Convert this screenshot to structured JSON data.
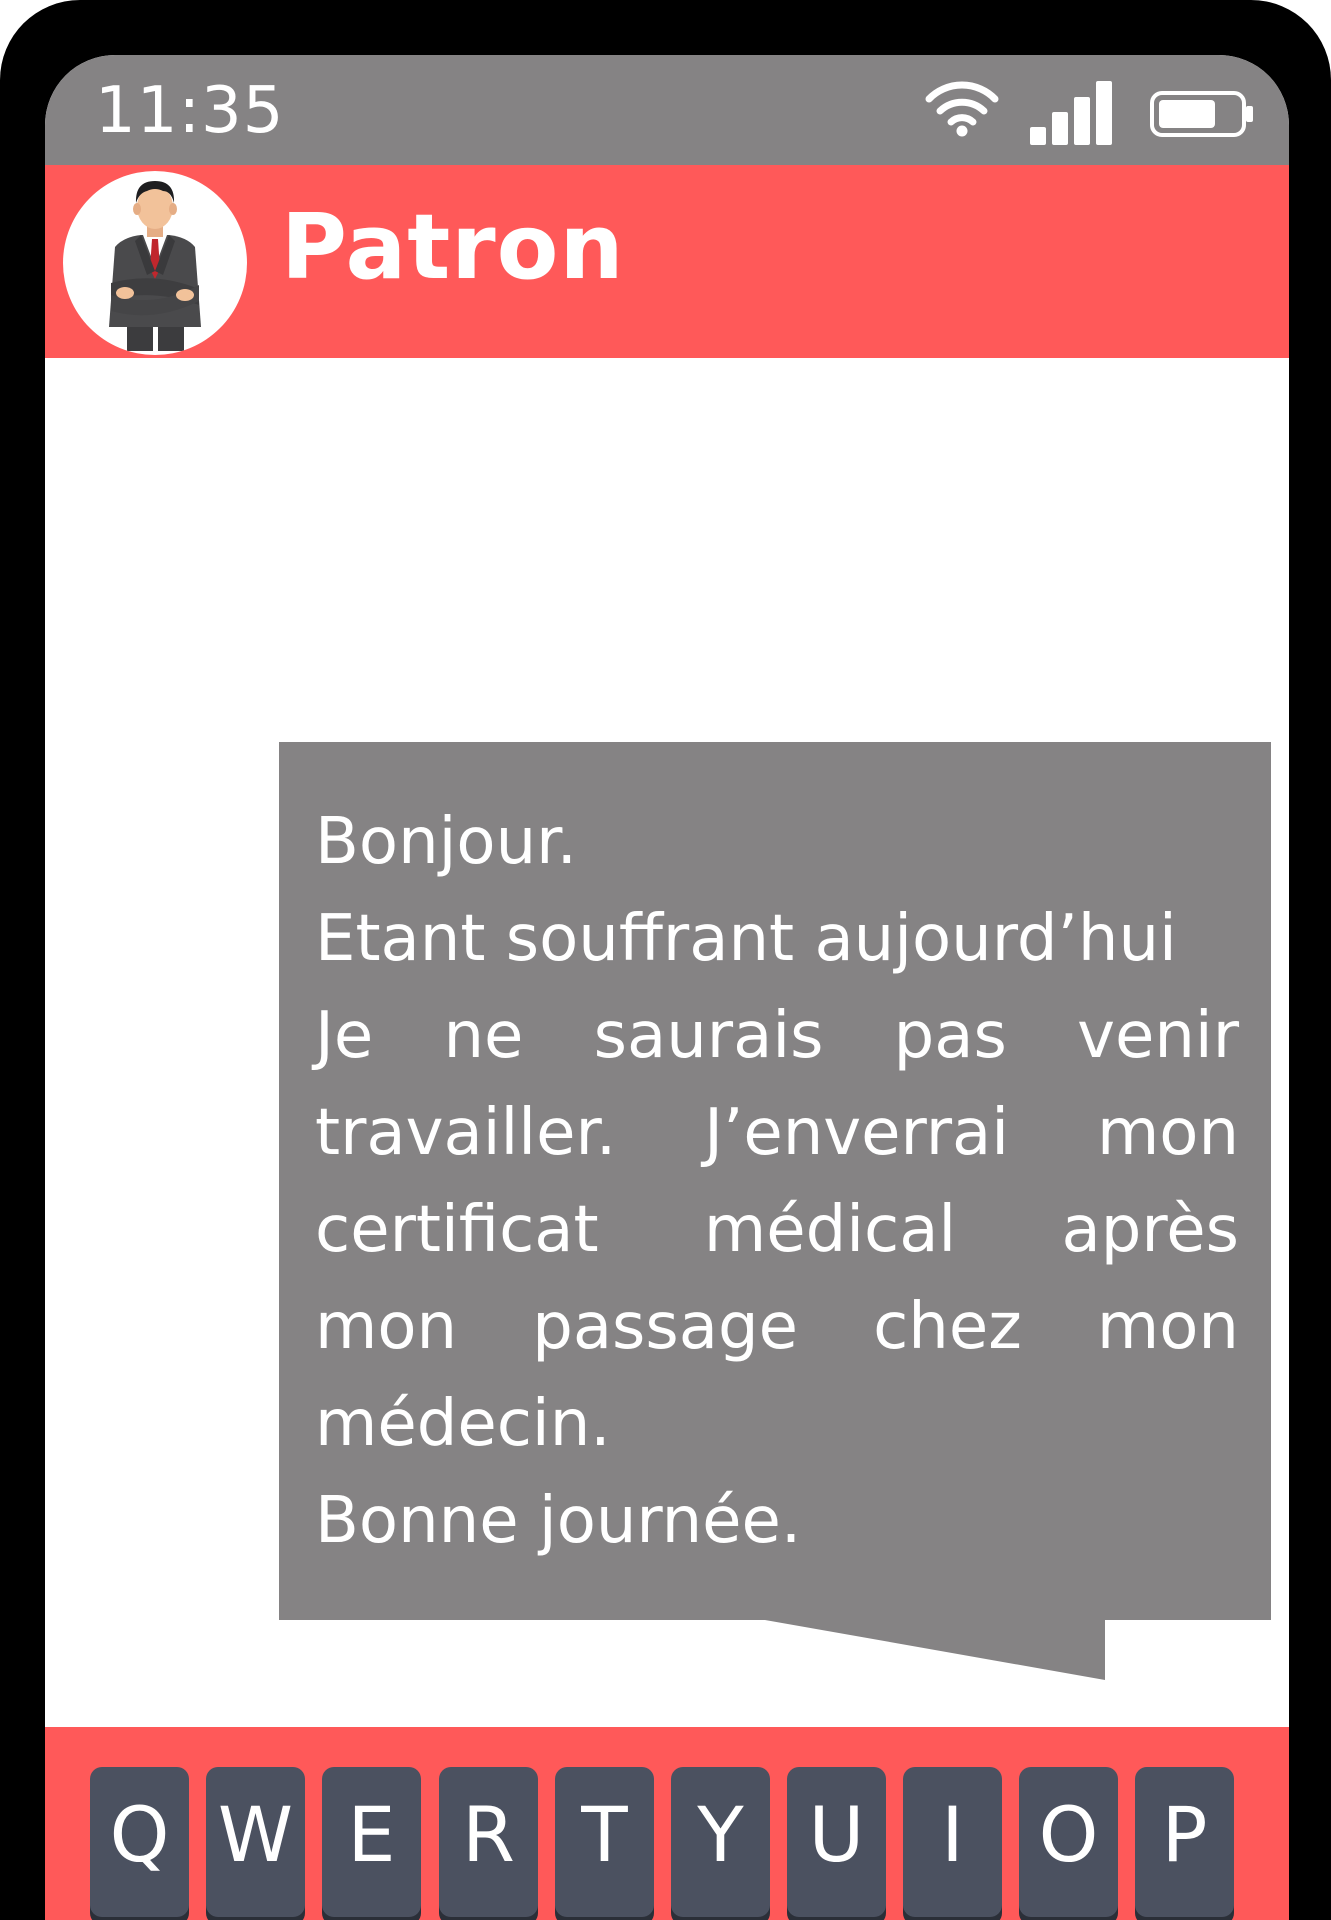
{
  "status_bar": {
    "time": "11:35",
    "icons": [
      "wifi-icon",
      "signal-icon",
      "battery-icon"
    ]
  },
  "header": {
    "contact_name": "Patron",
    "avatar_icon": "businessman-avatar-icon",
    "accent_color": "#ff5959"
  },
  "message": {
    "lines": [
      "Bonjour.",
      "Etant souffrant aujourd’hui",
      "Je ne saurais pas venir",
      "travailler. J’enverrai mon",
      "certificat médical après",
      "mon passage chez mon",
      "médecin.",
      "Bonne journée."
    ],
    "bubble_color": "#858384"
  },
  "keyboard": {
    "keys": [
      "Q",
      "W",
      "E",
      "R",
      "T",
      "Y",
      "U",
      "I",
      "O",
      "P"
    ],
    "key_color": "#4b5160"
  }
}
